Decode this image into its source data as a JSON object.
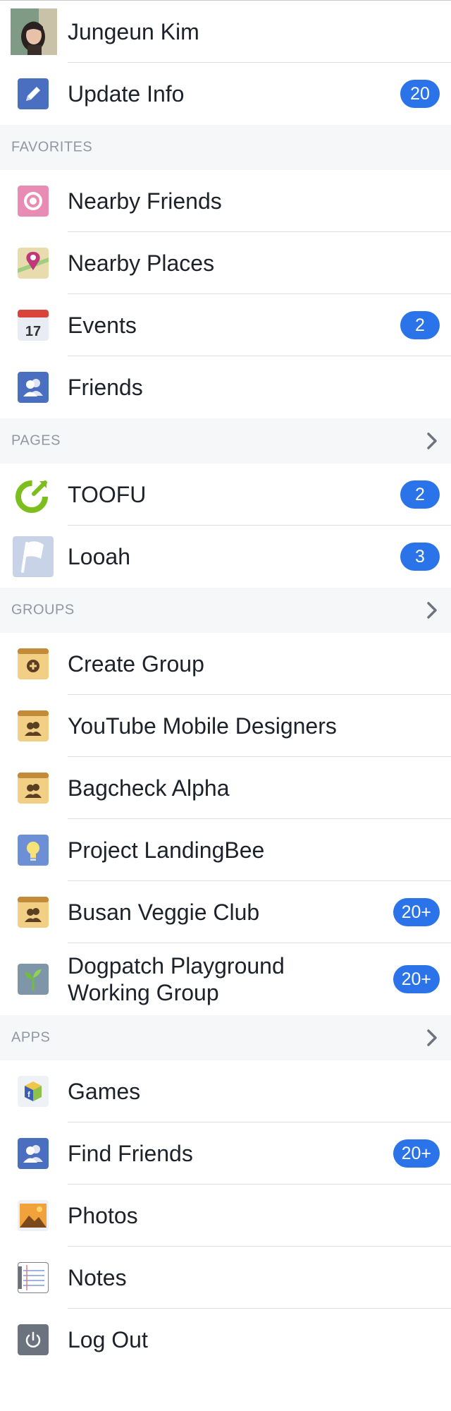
{
  "profile": {
    "name": "Jungeun Kim"
  },
  "update_info": {
    "label": "Update Info",
    "badge": "20"
  },
  "favorites": {
    "title": "FAVORITES",
    "items": [
      {
        "label": "Nearby Friends",
        "badge": "",
        "icon": "nearby-friends-icon"
      },
      {
        "label": "Nearby Places",
        "badge": "",
        "icon": "nearby-places-icon"
      },
      {
        "label": "Events",
        "badge": "2",
        "icon": "calendar-icon",
        "icon_text": "17"
      },
      {
        "label": "Friends",
        "badge": "",
        "icon": "friends-icon"
      }
    ]
  },
  "pages": {
    "title": "PAGES",
    "items": [
      {
        "label": "TOOFU",
        "badge": "2",
        "icon": "toofu-logo-icon"
      },
      {
        "label": "Looah",
        "badge": "3",
        "icon": "flag-icon"
      }
    ]
  },
  "groups": {
    "title": "GROUPS",
    "items": [
      {
        "label": "Create Group",
        "badge": "",
        "icon": "create-group-icon"
      },
      {
        "label": "YouTube Mobile Designers",
        "badge": "",
        "icon": "group-icon"
      },
      {
        "label": "Bagcheck Alpha",
        "badge": "",
        "icon": "group-icon"
      },
      {
        "label": "Project LandingBee",
        "badge": "",
        "icon": "lightbulb-icon"
      },
      {
        "label": "Busan Veggie Club",
        "badge": "20+",
        "icon": "group-icon"
      },
      {
        "label": "Dogpatch Playground Working Group",
        "badge": "20+",
        "icon": "sprout-icon"
      }
    ]
  },
  "apps": {
    "title": "APPS",
    "items": [
      {
        "label": "Games",
        "badge": "",
        "icon": "games-icon"
      },
      {
        "label": "Find Friends",
        "badge": "20+",
        "icon": "find-friends-icon"
      },
      {
        "label": "Photos",
        "badge": "",
        "icon": "photos-icon"
      },
      {
        "label": "Notes",
        "badge": "",
        "icon": "notes-icon"
      },
      {
        "label": "Log Out",
        "badge": "",
        "icon": "power-icon"
      }
    ]
  },
  "colors": {
    "badge": "#2b73e8",
    "section_bg": "#f6f7f9",
    "section_text": "#9197a3",
    "separator": "#dcdde1"
  }
}
